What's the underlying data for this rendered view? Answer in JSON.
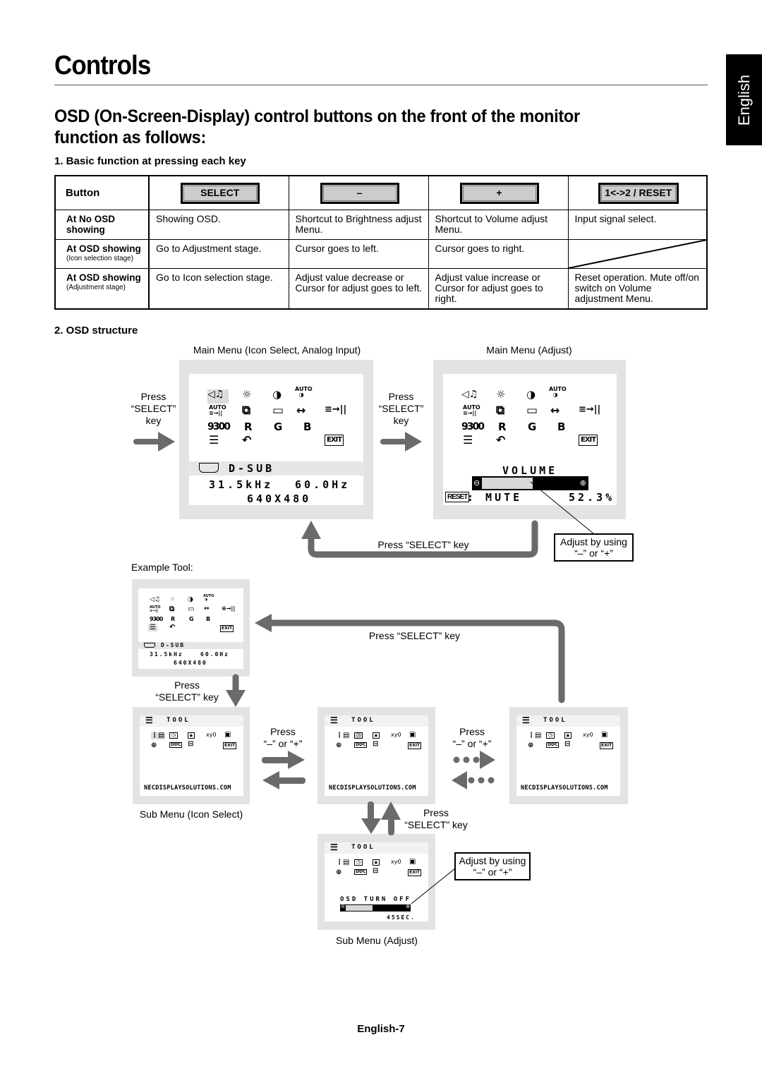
{
  "page": {
    "title": "Controls",
    "subtitle": "OSD (On-Screen-Display) control buttons on the front of the monitor function as follows:",
    "language_tab": "English",
    "footer": "English-7"
  },
  "section1": {
    "heading": "1. Basic function at pressing each key",
    "header_label": "Button",
    "keys": [
      "SELECT",
      "–",
      "+",
      "1<->2 / RESET"
    ],
    "rows": [
      {
        "label": "At No OSD showing",
        "sublabel": "",
        "cells": [
          "Showing OSD.",
          "Shortcut to Brightness adjust Menu.",
          "Shortcut to Volume adjust Menu.",
          "Input signal select."
        ]
      },
      {
        "label": "At OSD showing",
        "sublabel": "(Icon selection stage)",
        "cells": [
          "Go to Adjustment stage.",
          "Cursor goes to left.",
          "Cursor goes to right.",
          ""
        ]
      },
      {
        "label": "At OSD showing",
        "sublabel": "(Adjustment stage)",
        "cells": [
          "Go to Icon selection stage.",
          "Adjust value decrease or Cursor for adjust goes to left.",
          "Adjust value increase or Cursor for adjust goes to right.",
          "Reset operation. Mute off/on switch on Volume adjustment Menu."
        ]
      }
    ]
  },
  "section2": {
    "heading": "2. OSD structure",
    "main_menu_icon_label": "Main Menu (Icon Select, Analog Input)",
    "main_menu_adjust_label": "Main Menu (Adjust)",
    "press_select_left": [
      "Press",
      "“SELECT”",
      "key"
    ],
    "press_select_mid": [
      "Press",
      "“SELECT”",
      "key"
    ],
    "press_select_return": "Press “SELECT” key",
    "adjust_callout_1": [
      "Adjust by using",
      "“–” or “+”"
    ],
    "example_tool_label": "Example Tool:",
    "press_select_back": "Press “SELECT” key",
    "press_select_down": [
      "Press",
      "“SELECT” key"
    ],
    "press_minus_plus_1": [
      "Press",
      "“–” or “+”"
    ],
    "press_minus_plus_2": [
      "Press",
      "“–” or “+”"
    ],
    "press_select_sub": [
      "Press",
      "“SELECT” key"
    ],
    "sub_menu_icon_label": "Sub Menu (Icon Select)",
    "sub_menu_adjust_label": "Sub Menu (Adjust)",
    "adjust_callout_2": [
      "Adjust by using",
      "“–” or “+”"
    ]
  },
  "osd_main": {
    "icons_row1": [
      "◁♫",
      "☼",
      "◑",
      "AUTO◑"
    ],
    "icons_row2": [
      "AUTO",
      "▢",
      "□",
      "↔",
      "≡→||"
    ],
    "icons_row3": [
      "9300",
      "R",
      "G",
      "B"
    ],
    "icons_row4": [
      "tool",
      "↶",
      "EXIT"
    ],
    "input_name": "D-SUB",
    "h_freq": "31.5kHz",
    "v_freq": "60.0Hz",
    "resolution": "640X480"
  },
  "osd_adjust": {
    "item": "VOLUME",
    "reset_label": "RESET",
    "mute_label": ": MUTE",
    "value": "52.3%",
    "value_fraction": 0.523
  },
  "osd_tool": {
    "title": "TOOL",
    "url": "NECDISPLAYSOLUTIONS.COM",
    "exit": "EXIT",
    "xy": "xy0",
    "adjust_item": "OSD TURN OFF",
    "adjust_value": "45SEC.",
    "adjust_fraction": 0.45
  },
  "colors": {
    "arrow": "#6a6a6a",
    "frame": "#e3e3e3",
    "key_button": "#cccccc",
    "lang_tab": "#000000"
  }
}
